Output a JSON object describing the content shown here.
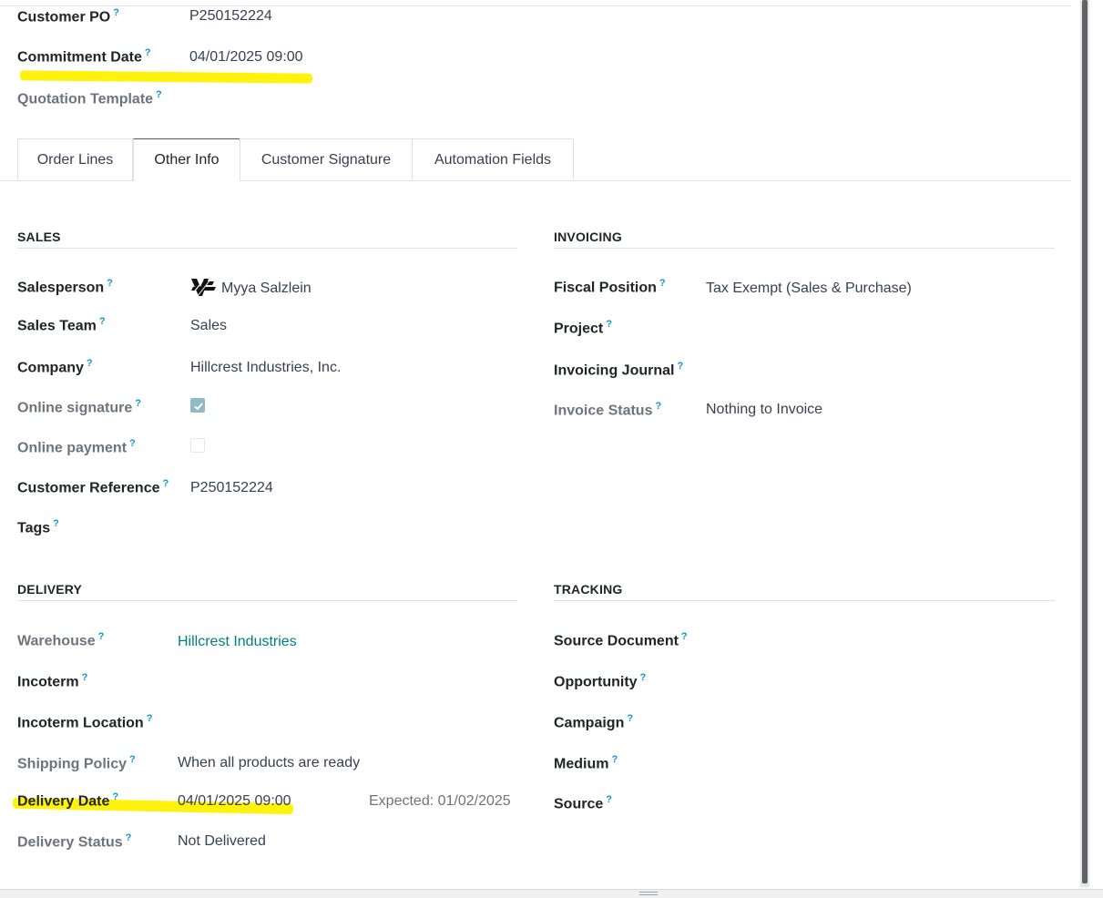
{
  "header_fields": {
    "customer_po": {
      "label": "Customer PO",
      "value": "P250152224"
    },
    "commitment_date": {
      "label": "Commitment Date",
      "value": "04/01/2025 09:00"
    },
    "quotation_template": {
      "label": "Quotation Template",
      "value": ""
    }
  },
  "help_mark": "?",
  "tabs": [
    {
      "label": "Order Lines",
      "active": false
    },
    {
      "label": "Other Info",
      "active": true
    },
    {
      "label": "Customer Signature",
      "active": false
    },
    {
      "label": "Automation Fields",
      "active": false
    }
  ],
  "sales": {
    "heading": "SALES",
    "salesperson": {
      "label": "Salesperson",
      "value": "Myya Salzlein"
    },
    "sales_team": {
      "label": "Sales Team",
      "value": "Sales"
    },
    "company": {
      "label": "Company",
      "value": "Hillcrest Industries, Inc."
    },
    "online_signature": {
      "label": "Online signature",
      "checked": true
    },
    "online_payment": {
      "label": "Online payment",
      "checked": false
    },
    "customer_reference": {
      "label": "Customer Reference",
      "value": "P250152224"
    },
    "tags": {
      "label": "Tags",
      "value": ""
    }
  },
  "invoicing": {
    "heading": "INVOICING",
    "fiscal_position": {
      "label": "Fiscal Position",
      "value": "Tax Exempt (Sales & Purchase)"
    },
    "project": {
      "label": "Project",
      "value": ""
    },
    "invoicing_journal": {
      "label": "Invoicing Journal",
      "value": ""
    },
    "invoice_status": {
      "label": "Invoice Status",
      "value": "Nothing to Invoice"
    }
  },
  "delivery": {
    "heading": "DELIVERY",
    "warehouse": {
      "label": "Warehouse",
      "value": "Hillcrest Industries"
    },
    "incoterm": {
      "label": "Incoterm",
      "value": ""
    },
    "incoterm_location": {
      "label": "Incoterm Location",
      "value": ""
    },
    "shipping_policy": {
      "label": "Shipping Policy",
      "value": "When all products are ready"
    },
    "delivery_date": {
      "label": "Delivery Date",
      "value": "04/01/2025 09:00",
      "expected": "Expected: 01/02/2025"
    },
    "delivery_status": {
      "label": "Delivery Status",
      "value": "Not Delivered"
    }
  },
  "tracking": {
    "heading": "TRACKING",
    "source_document": {
      "label": "Source Document"
    },
    "opportunity": {
      "label": "Opportunity"
    },
    "campaign": {
      "label": "Campaign"
    },
    "medium": {
      "label": "Medium"
    },
    "source": {
      "label": "Source"
    }
  },
  "colors": {
    "highlight": "#fff200",
    "link": "#017e84",
    "help_mark": "#0d98c9",
    "active_tab_top": "#6f4a68",
    "checkbox_on": "#8fbcc4"
  },
  "icons": {
    "avatar": "company-logo-avatar-icon",
    "checkbox_on": "checkmark-icon",
    "grip": "resize-grip-icon"
  }
}
